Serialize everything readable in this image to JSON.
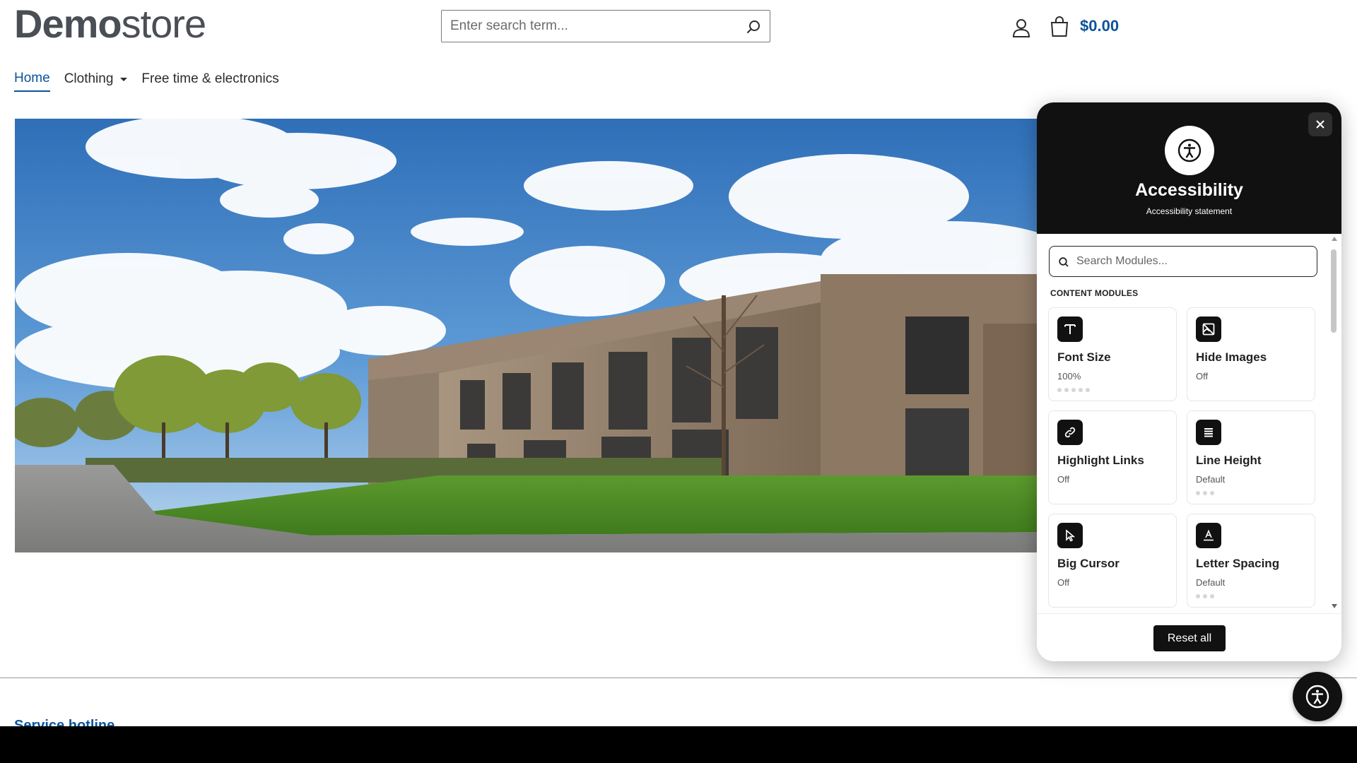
{
  "header": {
    "logo_bold": "Demo",
    "logo_light": "store",
    "search_placeholder": "Enter search term...",
    "cart_total": "$0.00"
  },
  "nav": {
    "items": [
      {
        "label": "Home",
        "active": true
      },
      {
        "label": "Clothing",
        "has_dropdown": true
      },
      {
        "label": "Free time & electronics"
      }
    ]
  },
  "hero": {
    "icon": "building-photo"
  },
  "footer": {
    "heading": "Service hotline"
  },
  "accessibility": {
    "title": "Accessibility",
    "statement_link": "Accessibility statement",
    "search_placeholder": "Search Modules...",
    "section_label": "CONTENT MODULES",
    "modules": [
      {
        "title": "Font Size",
        "status": "100%",
        "icon": "text-icon",
        "dots": 5
      },
      {
        "title": "Hide Images",
        "status": "Off",
        "icon": "image-off-icon",
        "dots": 0
      },
      {
        "title": "Highlight Links",
        "status": "Off",
        "icon": "link-icon",
        "dots": 0
      },
      {
        "title": "Line Height",
        "status": "Default",
        "icon": "lines-icon",
        "dots": 3
      },
      {
        "title": "Big Cursor",
        "status": "Off",
        "icon": "cursor-icon",
        "dots": 0
      },
      {
        "title": "Letter Spacing",
        "status": "Default",
        "icon": "letter-spacing-icon",
        "dots": 3
      }
    ],
    "reset_label": "Reset all"
  },
  "colors": {
    "brand": "#0b539b",
    "panel_dark": "#111111"
  }
}
